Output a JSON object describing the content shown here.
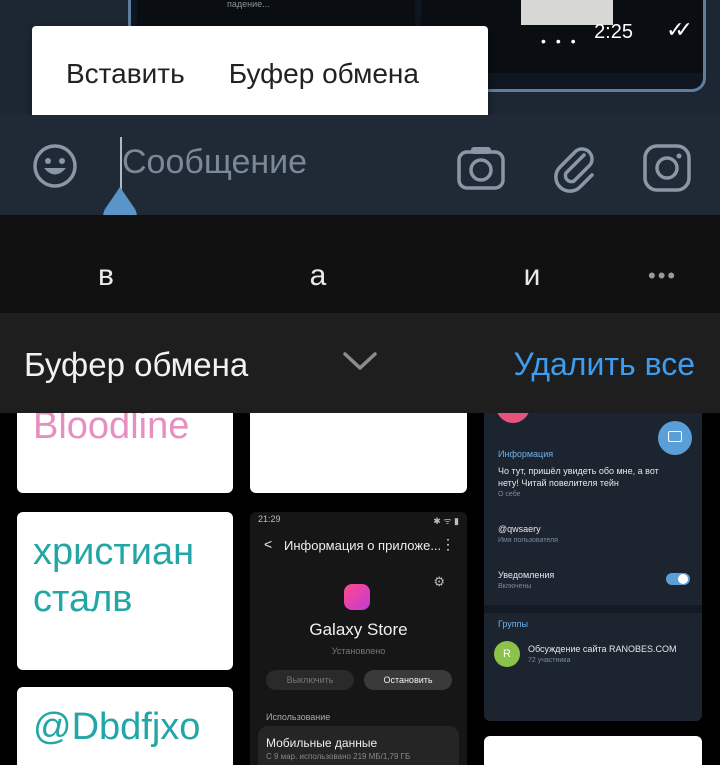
{
  "chat": {
    "preview_text": "падение...",
    "message_time": "2:25",
    "read_status": "✓✓"
  },
  "context_menu": {
    "paste": "Вставить",
    "clipboard": "Буфер обмена"
  },
  "input": {
    "placeholder": "Сообщение"
  },
  "suggestions": [
    "в",
    "а",
    "и"
  ],
  "suggestion_more": "•••",
  "clipboard": {
    "title": "Буфер обмена",
    "delete_all": "Удалить все",
    "items": [
      {
        "text": "Bloodline",
        "color": "#e68fc0"
      },
      {
        "text": "христиан сталв",
        "color": "#23a6a6"
      },
      {
        "text": "@Dbdfjxo",
        "color": "#23a6a6"
      }
    ]
  },
  "screenshot1": {
    "status_left": "21:29",
    "status_right": "✱ ᯤ ▮",
    "back": "<",
    "title": "Информация о приложе...",
    "kebab": "⋮",
    "gear": "⚙",
    "app_name": "Galaxy Store",
    "installed": "Установлено",
    "btn_disable": "Выключить",
    "btn_stop": "Остановить",
    "section": "Использование",
    "mobile_data": "Мобильные данные",
    "mobile_data_sub": "С 9 мар. использовано 219 МБ/1,79 ГБ"
  },
  "screenshot2": {
    "info_label": "Информация",
    "bio": "Чо тут, пришёл увидеть обо мне, а вот нету! Читай повелителя тейн",
    "bio_sub": "О себе",
    "username": "@qwsaery",
    "username_sub": "Имя пользователя",
    "notifications": "Уведомления",
    "notifications_sub": "Включены",
    "groups_label": "Группы",
    "group_initial": "R",
    "group_name": "Обсуждение сайта RANOBES.COM",
    "group_members": "72 участника"
  },
  "colors": {
    "accent_blue": "#3d9df0",
    "handle_blue": "#5b95c7"
  }
}
